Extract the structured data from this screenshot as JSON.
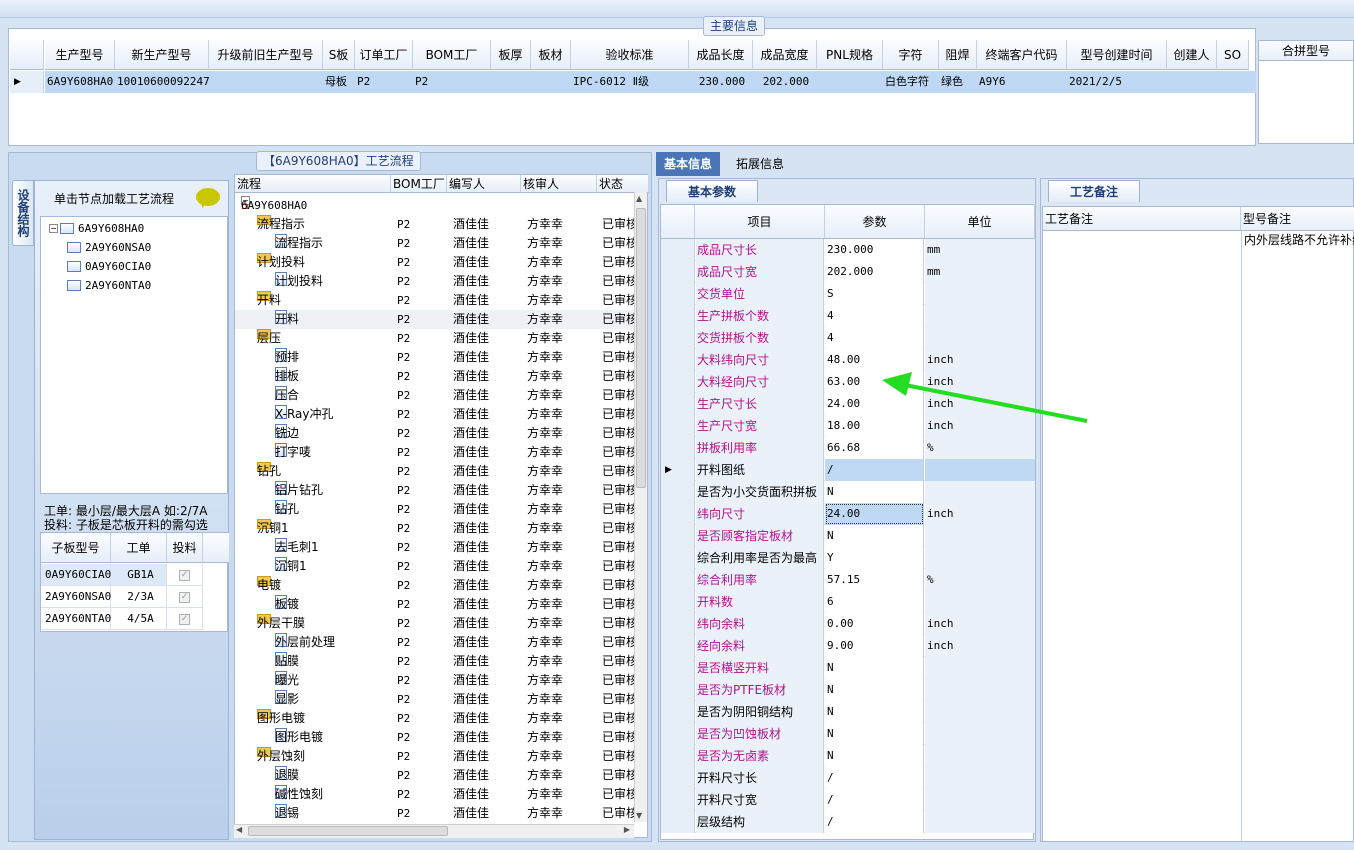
{
  "main": {
    "legend": "主要信息",
    "columns": [
      "生产型号",
      "新生产型号",
      "升级前旧生产型号",
      "S板",
      "订单工厂",
      "BOM工厂",
      "板厚",
      "板材",
      "验收标准",
      "成品长度",
      "成品宽度",
      "PNL规格",
      "字符",
      "阻焊",
      "终端客户代码",
      "型号创建时间",
      "创建人",
      "SO"
    ],
    "row": [
      "6A9Y608HA0",
      "10010600092247",
      "",
      "母板",
      "P2",
      "P2",
      "",
      "",
      "IPC-6012 Ⅱ级",
      "230.000",
      "202.000",
      "",
      "白色字符",
      "绿色",
      "A9Y6",
      "2021/2/5",
      "",
      ""
    ],
    "merge_header": "合拼型号"
  },
  "flow": {
    "legend_prefix": "【6A9Y608HA0】",
    "legend_suffix": "工艺流程",
    "side_tab": "设备结构",
    "load_hint": "单击节点加载工艺流程",
    "struct_tree": [
      "6A9Y608HA0",
      "2A9Y60NSA0",
      "0A9Y60CIA0",
      "2A9Y60NTA0"
    ],
    "note1": "工单: 最小层/最大层A 如:2/7A",
    "note2": "投料: 子板是芯板开料的需勾选",
    "sub_columns": [
      "子板型号",
      "工单",
      "投料"
    ],
    "sub_rows": [
      [
        "0A9Y60CIA0",
        "GB1A"
      ],
      [
        "2A9Y60NSA0",
        "2/3A"
      ],
      [
        "2A9Y60NTA0",
        "4/5A"
      ]
    ],
    "grid_columns": [
      "流程",
      "BOM工厂",
      "编写人",
      "核审人",
      "状态"
    ],
    "root": "6A9Y608HA0",
    "bom": "P2",
    "writer": "酒佳佳",
    "reviewer": "方幸幸",
    "status": "已审核",
    "rows": [
      {
        "name": "流程指示",
        "level": 1
      },
      {
        "name": "流程指示",
        "level": 2
      },
      {
        "name": "计划投料",
        "level": 1
      },
      {
        "name": "计划投料",
        "level": 2
      },
      {
        "name": "开料",
        "level": 1
      },
      {
        "name": "开料",
        "level": 2
      },
      {
        "name": "层压",
        "level": 1
      },
      {
        "name": "预排",
        "level": 2
      },
      {
        "name": "排板",
        "level": 2
      },
      {
        "name": "压合",
        "level": 2
      },
      {
        "name": "X-Ray冲孔",
        "level": 2
      },
      {
        "name": "铣边",
        "level": 2
      },
      {
        "name": "打字唛",
        "level": 2
      },
      {
        "name": "钻孔",
        "level": 1
      },
      {
        "name": "铝片钻孔",
        "level": 2
      },
      {
        "name": "钻孔",
        "level": 2
      },
      {
        "name": "沉铜1",
        "level": 1
      },
      {
        "name": "去毛刺1",
        "level": 2
      },
      {
        "name": "沉铜1",
        "level": 2
      },
      {
        "name": "电镀",
        "level": 1
      },
      {
        "name": "板镀",
        "level": 2
      },
      {
        "name": "外层干膜",
        "level": 1
      },
      {
        "name": "外层前处理",
        "level": 2
      },
      {
        "name": "贴膜",
        "level": 2
      },
      {
        "name": "曝光",
        "level": 2
      },
      {
        "name": "显影",
        "level": 2
      },
      {
        "name": "图形电镀",
        "level": 1
      },
      {
        "name": "图形电镀",
        "level": 2
      },
      {
        "name": "外层蚀刻",
        "level": 1
      },
      {
        "name": "退膜",
        "level": 2
      },
      {
        "name": "碱性蚀刻",
        "level": 2
      },
      {
        "name": "退锡",
        "level": 2
      }
    ]
  },
  "right": {
    "tab_basic": "基本信息",
    "tab_ext": "拓展信息",
    "sub_tab": "基本参数",
    "param_columns": [
      "项目",
      "参数",
      "单位"
    ],
    "params": [
      {
        "item": "成品尺寸长",
        "value": "230.000",
        "unit": "mm",
        "mag": true
      },
      {
        "item": "成品尺寸宽",
        "value": "202.000",
        "unit": "mm",
        "mag": true
      },
      {
        "item": "交货单位",
        "value": "S",
        "unit": "",
        "mag": true
      },
      {
        "item": "生产拼板个数",
        "value": "4",
        "unit": "",
        "mag": true
      },
      {
        "item": "交货拼板个数",
        "value": "4",
        "unit": "",
        "mag": true
      },
      {
        "item": "大料纬向尺寸",
        "value": "48.00",
        "unit": "inch",
        "mag": true
      },
      {
        "item": "大料经向尺寸",
        "value": "63.00",
        "unit": "inch",
        "mag": true
      },
      {
        "item": "生产尺寸长",
        "value": "24.00",
        "unit": "inch",
        "mag": true
      },
      {
        "item": "生产尺寸宽",
        "value": "18.00",
        "unit": "inch",
        "mag": true
      },
      {
        "item": "拼板利用率",
        "value": "66.68",
        "unit": "%",
        "mag": true
      },
      {
        "item": "开料图纸",
        "value": "/",
        "unit": "",
        "mag": false,
        "current": true
      },
      {
        "item": "是否为小交货面积拼板",
        "value": "N",
        "unit": "",
        "mag": false
      },
      {
        "item": "纬向尺寸",
        "value": "24.00",
        "unit": "inch",
        "mag": true,
        "selected": true
      },
      {
        "item": "是否顾客指定板材",
        "value": "N",
        "unit": "",
        "mag": true
      },
      {
        "item": "综合利用率是否为最高",
        "value": "Y",
        "unit": "",
        "mag": false
      },
      {
        "item": "综合利用率",
        "value": "57.15",
        "unit": "%",
        "mag": true
      },
      {
        "item": "开料数",
        "value": "6",
        "unit": "",
        "mag": true
      },
      {
        "item": "纬向余料",
        "value": "0.00",
        "unit": "inch",
        "mag": true
      },
      {
        "item": "经向余料",
        "value": "9.00",
        "unit": "inch",
        "mag": true
      },
      {
        "item": "是否横竖开料",
        "value": "N",
        "unit": "",
        "mag": true
      },
      {
        "item": "是否为PTFE板材",
        "value": "N",
        "unit": "",
        "mag": true
      },
      {
        "item": "是否为阴阳铜结构",
        "value": "N",
        "unit": "",
        "mag": false
      },
      {
        "item": "是否为凹蚀板材",
        "value": "N",
        "unit": "",
        "mag": true
      },
      {
        "item": "是否为无卤素",
        "value": "N",
        "unit": "",
        "mag": true
      },
      {
        "item": "开料尺寸长",
        "value": "/",
        "unit": "",
        "mag": false
      },
      {
        "item": "开料尺寸宽",
        "value": "/",
        "unit": "",
        "mag": false
      },
      {
        "item": "层级结构",
        "value": "/",
        "unit": "",
        "mag": false
      }
    ],
    "remark_tab": "工艺备注",
    "remark_columns": [
      "工艺备注",
      "型号备注"
    ],
    "model_remark": "内外层线路不允许补线"
  },
  "colors": {
    "magenta": "#b0148c",
    "selected_row": "#bfd9f5",
    "arrow": "#22dd22"
  }
}
